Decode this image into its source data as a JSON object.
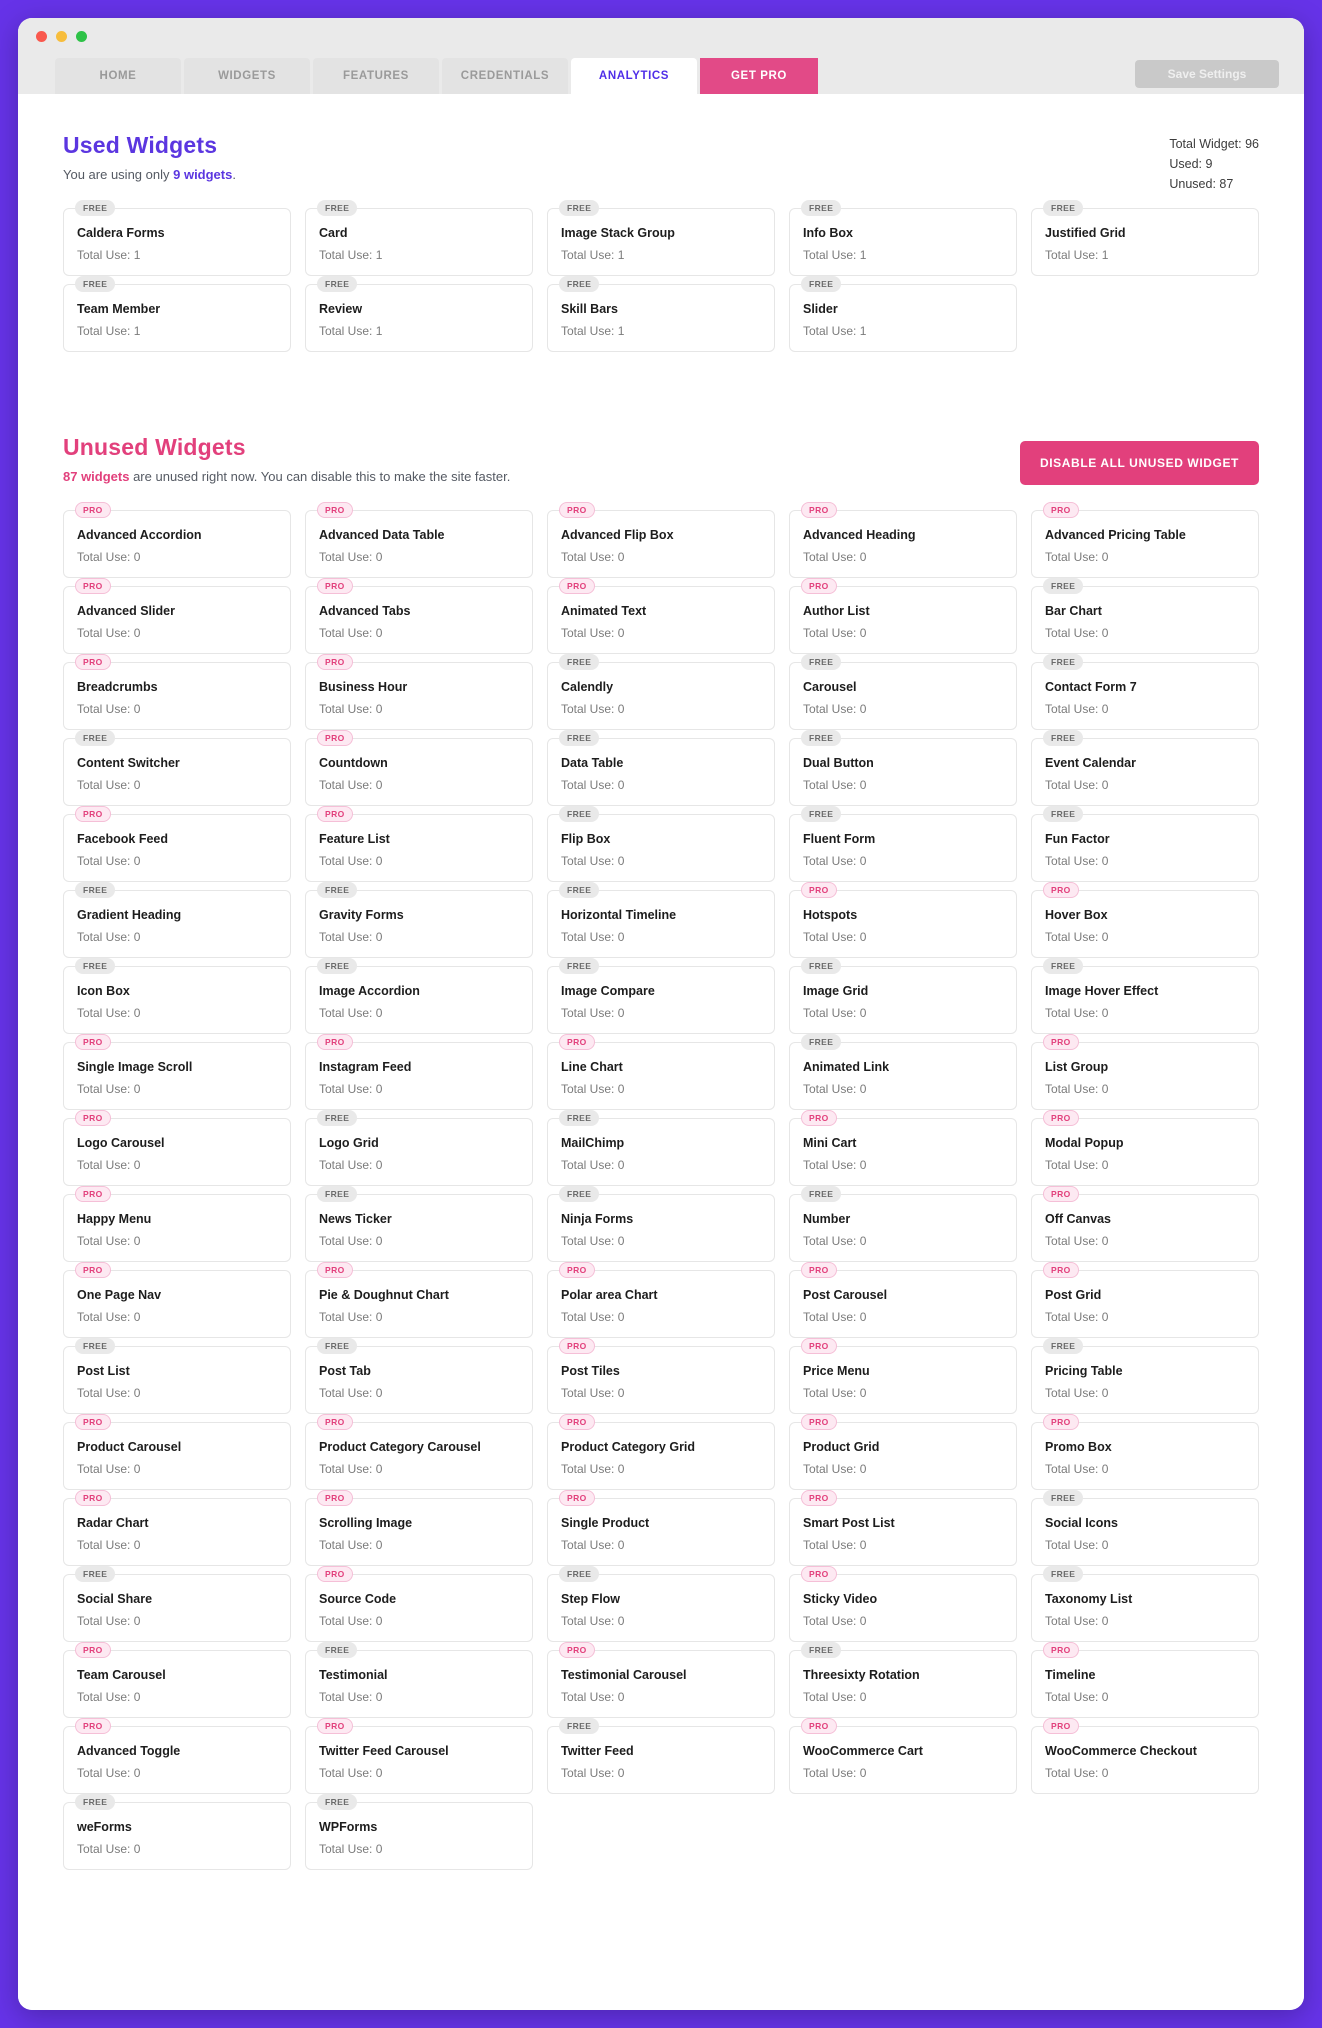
{
  "window": {
    "traffic_lights": [
      "red",
      "yellow",
      "green"
    ]
  },
  "tabs": [
    {
      "label": "HOME",
      "active": false,
      "style": "normal"
    },
    {
      "label": "WIDGETS",
      "active": false,
      "style": "normal"
    },
    {
      "label": "FEATURES",
      "active": false,
      "style": "normal"
    },
    {
      "label": "CREDENTIALS",
      "active": false,
      "style": "normal"
    },
    {
      "label": "ANALYTICS",
      "active": true,
      "style": "normal"
    },
    {
      "label": "GET PRO",
      "active": false,
      "style": "pro"
    }
  ],
  "save_button": {
    "label": "Save Settings"
  },
  "used_section": {
    "title": "Used Widgets",
    "sub_prefix": "You are using only ",
    "sub_highlight": "9 widgets",
    "sub_suffix": ".",
    "stats": {
      "total": "Total Widget: 96",
      "used": "Used: 9",
      "unused": "Unused: 87"
    },
    "widgets": [
      {
        "badge": "FREE",
        "name": "Caldera Forms",
        "use": "Total Use: 1"
      },
      {
        "badge": "FREE",
        "name": "Card",
        "use": "Total Use: 1"
      },
      {
        "badge": "FREE",
        "name": "Image Stack Group",
        "use": "Total Use: 1"
      },
      {
        "badge": "FREE",
        "name": "Info Box",
        "use": "Total Use: 1"
      },
      {
        "badge": "FREE",
        "name": "Justified Grid",
        "use": "Total Use: 1"
      },
      {
        "badge": "FREE",
        "name": "Team Member",
        "use": "Total Use: 1"
      },
      {
        "badge": "FREE",
        "name": "Review",
        "use": "Total Use: 1"
      },
      {
        "badge": "FREE",
        "name": "Skill Bars",
        "use": "Total Use: 1"
      },
      {
        "badge": "FREE",
        "name": "Slider",
        "use": "Total Use: 1"
      }
    ]
  },
  "unused_section": {
    "title": "Unused Widgets",
    "sub_highlight": "87 widgets",
    "sub_suffix": " are unused right now. You can disable this to make the site faster.",
    "disable_button": "DISABLE ALL UNUSED WIDGET",
    "widgets": [
      {
        "badge": "PRO",
        "name": "Advanced Accordion",
        "use": "Total Use: 0"
      },
      {
        "badge": "PRO",
        "name": "Advanced Data Table",
        "use": "Total Use: 0"
      },
      {
        "badge": "PRO",
        "name": "Advanced Flip Box",
        "use": "Total Use: 0"
      },
      {
        "badge": "PRO",
        "name": "Advanced Heading",
        "use": "Total Use: 0"
      },
      {
        "badge": "PRO",
        "name": "Advanced Pricing Table",
        "use": "Total Use: 0"
      },
      {
        "badge": "PRO",
        "name": "Advanced Slider",
        "use": "Total Use: 0"
      },
      {
        "badge": "PRO",
        "name": "Advanced Tabs",
        "use": "Total Use: 0"
      },
      {
        "badge": "PRO",
        "name": "Animated Text",
        "use": "Total Use: 0"
      },
      {
        "badge": "PRO",
        "name": "Author List",
        "use": "Total Use: 0"
      },
      {
        "badge": "FREE",
        "name": "Bar Chart",
        "use": "Total Use: 0"
      },
      {
        "badge": "PRO",
        "name": "Breadcrumbs",
        "use": "Total Use: 0"
      },
      {
        "badge": "PRO",
        "name": "Business Hour",
        "use": "Total Use: 0"
      },
      {
        "badge": "FREE",
        "name": "Calendly",
        "use": "Total Use: 0"
      },
      {
        "badge": "FREE",
        "name": "Carousel",
        "use": "Total Use: 0"
      },
      {
        "badge": "FREE",
        "name": "Contact Form 7",
        "use": "Total Use: 0"
      },
      {
        "badge": "FREE",
        "name": "Content Switcher",
        "use": "Total Use: 0"
      },
      {
        "badge": "PRO",
        "name": "Countdown",
        "use": "Total Use: 0"
      },
      {
        "badge": "FREE",
        "name": "Data Table",
        "use": "Total Use: 0"
      },
      {
        "badge": "FREE",
        "name": "Dual Button",
        "use": "Total Use: 0"
      },
      {
        "badge": "FREE",
        "name": "Event Calendar",
        "use": "Total Use: 0"
      },
      {
        "badge": "PRO",
        "name": "Facebook Feed",
        "use": "Total Use: 0"
      },
      {
        "badge": "PRO",
        "name": "Feature List",
        "use": "Total Use: 0"
      },
      {
        "badge": "FREE",
        "name": "Flip Box",
        "use": "Total Use: 0"
      },
      {
        "badge": "FREE",
        "name": "Fluent Form",
        "use": "Total Use: 0"
      },
      {
        "badge": "FREE",
        "name": "Fun Factor",
        "use": "Total Use: 0"
      },
      {
        "badge": "FREE",
        "name": "Gradient Heading",
        "use": "Total Use: 0"
      },
      {
        "badge": "FREE",
        "name": "Gravity Forms",
        "use": "Total Use: 0"
      },
      {
        "badge": "FREE",
        "name": "Horizontal Timeline",
        "use": "Total Use: 0"
      },
      {
        "badge": "PRO",
        "name": "Hotspots",
        "use": "Total Use: 0"
      },
      {
        "badge": "PRO",
        "name": "Hover Box",
        "use": "Total Use: 0"
      },
      {
        "badge": "FREE",
        "name": "Icon Box",
        "use": "Total Use: 0"
      },
      {
        "badge": "FREE",
        "name": "Image Accordion",
        "use": "Total Use: 0"
      },
      {
        "badge": "FREE",
        "name": "Image Compare",
        "use": "Total Use: 0"
      },
      {
        "badge": "FREE",
        "name": "Image Grid",
        "use": "Total Use: 0"
      },
      {
        "badge": "FREE",
        "name": "Image Hover Effect",
        "use": "Total Use: 0"
      },
      {
        "badge": "PRO",
        "name": "Single Image Scroll",
        "use": "Total Use: 0"
      },
      {
        "badge": "PRO",
        "name": "Instagram Feed",
        "use": "Total Use: 0"
      },
      {
        "badge": "PRO",
        "name": "Line Chart",
        "use": "Total Use: 0"
      },
      {
        "badge": "FREE",
        "name": "Animated Link",
        "use": "Total Use: 0"
      },
      {
        "badge": "PRO",
        "name": "List Group",
        "use": "Total Use: 0"
      },
      {
        "badge": "PRO",
        "name": "Logo Carousel",
        "use": "Total Use: 0"
      },
      {
        "badge": "FREE",
        "name": "Logo Grid",
        "use": "Total Use: 0"
      },
      {
        "badge": "FREE",
        "name": "MailChimp",
        "use": "Total Use: 0"
      },
      {
        "badge": "PRO",
        "name": "Mini Cart",
        "use": "Total Use: 0"
      },
      {
        "badge": "PRO",
        "name": "Modal Popup",
        "use": "Total Use: 0"
      },
      {
        "badge": "PRO",
        "name": "Happy Menu",
        "use": "Total Use: 0"
      },
      {
        "badge": "FREE",
        "name": "News Ticker",
        "use": "Total Use: 0"
      },
      {
        "badge": "FREE",
        "name": "Ninja Forms",
        "use": "Total Use: 0"
      },
      {
        "badge": "FREE",
        "name": "Number",
        "use": "Total Use: 0"
      },
      {
        "badge": "PRO",
        "name": "Off Canvas",
        "use": "Total Use: 0"
      },
      {
        "badge": "PRO",
        "name": "One Page Nav",
        "use": "Total Use: 0"
      },
      {
        "badge": "PRO",
        "name": "Pie & Doughnut Chart",
        "use": "Total Use: 0"
      },
      {
        "badge": "PRO",
        "name": "Polar area Chart",
        "use": "Total Use: 0"
      },
      {
        "badge": "PRO",
        "name": "Post Carousel",
        "use": "Total Use: 0"
      },
      {
        "badge": "PRO",
        "name": "Post Grid",
        "use": "Total Use: 0"
      },
      {
        "badge": "FREE",
        "name": "Post List",
        "use": "Total Use: 0"
      },
      {
        "badge": "FREE",
        "name": "Post Tab",
        "use": "Total Use: 0"
      },
      {
        "badge": "PRO",
        "name": "Post Tiles",
        "use": "Total Use: 0"
      },
      {
        "badge": "PRO",
        "name": "Price Menu",
        "use": "Total Use: 0"
      },
      {
        "badge": "FREE",
        "name": "Pricing Table",
        "use": "Total Use: 0"
      },
      {
        "badge": "PRO",
        "name": "Product Carousel",
        "use": "Total Use: 0"
      },
      {
        "badge": "PRO",
        "name": "Product Category Carousel",
        "use": "Total Use: 0"
      },
      {
        "badge": "PRO",
        "name": "Product Category Grid",
        "use": "Total Use: 0"
      },
      {
        "badge": "PRO",
        "name": "Product Grid",
        "use": "Total Use: 0"
      },
      {
        "badge": "PRO",
        "name": "Promo Box",
        "use": "Total Use: 0"
      },
      {
        "badge": "PRO",
        "name": "Radar Chart",
        "use": "Total Use: 0"
      },
      {
        "badge": "PRO",
        "name": "Scrolling Image",
        "use": "Total Use: 0"
      },
      {
        "badge": "PRO",
        "name": "Single Product",
        "use": "Total Use: 0"
      },
      {
        "badge": "PRO",
        "name": "Smart Post List",
        "use": "Total Use: 0"
      },
      {
        "badge": "FREE",
        "name": "Social Icons",
        "use": "Total Use: 0"
      },
      {
        "badge": "FREE",
        "name": "Social Share",
        "use": "Total Use: 0"
      },
      {
        "badge": "PRO",
        "name": "Source Code",
        "use": "Total Use: 0"
      },
      {
        "badge": "FREE",
        "name": "Step Flow",
        "use": "Total Use: 0"
      },
      {
        "badge": "PRO",
        "name": "Sticky Video",
        "use": "Total Use: 0"
      },
      {
        "badge": "FREE",
        "name": "Taxonomy List",
        "use": "Total Use: 0"
      },
      {
        "badge": "PRO",
        "name": "Team Carousel",
        "use": "Total Use: 0"
      },
      {
        "badge": "FREE",
        "name": "Testimonial",
        "use": "Total Use: 0"
      },
      {
        "badge": "PRO",
        "name": "Testimonial Carousel",
        "use": "Total Use: 0"
      },
      {
        "badge": "FREE",
        "name": "Threesixty Rotation",
        "use": "Total Use: 0"
      },
      {
        "badge": "PRO",
        "name": "Timeline",
        "use": "Total Use: 0"
      },
      {
        "badge": "PRO",
        "name": "Advanced Toggle",
        "use": "Total Use: 0"
      },
      {
        "badge": "PRO",
        "name": "Twitter Feed Carousel",
        "use": "Total Use: 0"
      },
      {
        "badge": "FREE",
        "name": "Twitter Feed",
        "use": "Total Use: 0"
      },
      {
        "badge": "PRO",
        "name": "WooCommerce Cart",
        "use": "Total Use: 0"
      },
      {
        "badge": "PRO",
        "name": "WooCommerce Checkout",
        "use": "Total Use: 0"
      },
      {
        "badge": "FREE",
        "name": "weForms",
        "use": "Total Use: 0"
      },
      {
        "badge": "FREE",
        "name": "WPForms",
        "use": "Total Use: 0"
      }
    ]
  },
  "colors": {
    "brand_purple": "#5b36e0",
    "brand_pink": "#e2407c",
    "desktop": "#6633e8"
  }
}
